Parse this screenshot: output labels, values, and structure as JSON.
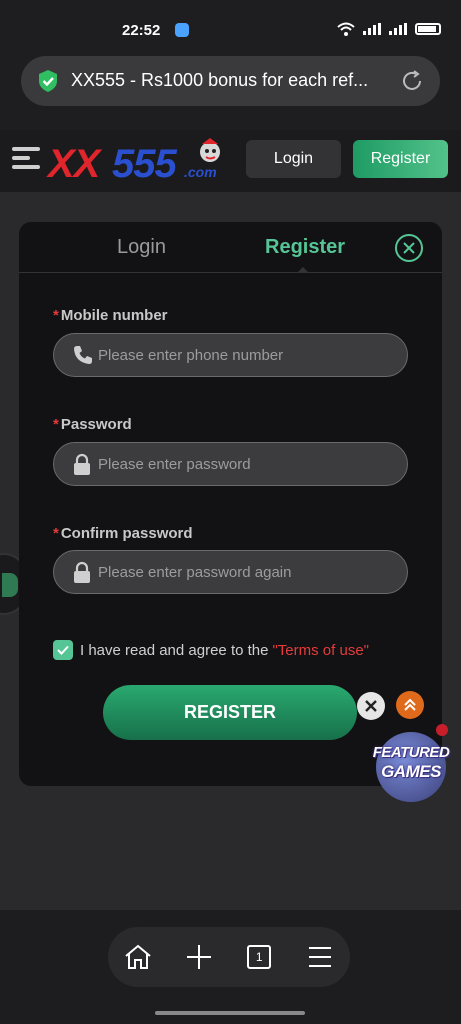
{
  "status_bar": {
    "time": "22:52",
    "icons": [
      "app-notification-icon",
      "wifi-icon",
      "signal-icon",
      "signal-icon",
      "battery-icon"
    ]
  },
  "browser": {
    "url_title": "XX555 - Rs1000 bonus for each ref...",
    "secure_icon": "shield-check-icon",
    "reload_icon": "reload-icon"
  },
  "site_header": {
    "logo_text_red": "XX",
    "logo_text_blue": "555",
    "logo_suffix": ".com",
    "login_label": "Login",
    "register_label": "Register"
  },
  "modal": {
    "tabs": [
      {
        "label": "Login",
        "active": false
      },
      {
        "label": "Register",
        "active": true
      }
    ],
    "required_mark": "*",
    "fields": {
      "mobile": {
        "label": "Mobile number",
        "placeholder": "Please enter phone number",
        "icon": "phone-icon"
      },
      "password": {
        "label": "Password",
        "placeholder": "Please enter password",
        "icon": "lock-icon"
      },
      "confirm": {
        "label": "Confirm password",
        "placeholder": "Please enter password again",
        "icon": "lock-icon"
      }
    },
    "agree_text": "I have read and agree to the",
    "terms_text": "\"Terms of use\"",
    "agree_checked": true,
    "submit_label": "REGISTER"
  },
  "floating": {
    "featured_line1": "FEATURED",
    "featured_line2": "GAMES"
  },
  "bottom_nav": {
    "tab_count": "1",
    "icons": [
      "home-icon",
      "plus-icon",
      "tabs-icon",
      "menu-icon"
    ]
  },
  "colors": {
    "accent_green": "#56c596",
    "required_red": "#e53b3b",
    "background": "#2a2a2c",
    "modal_bg": "#121214"
  }
}
